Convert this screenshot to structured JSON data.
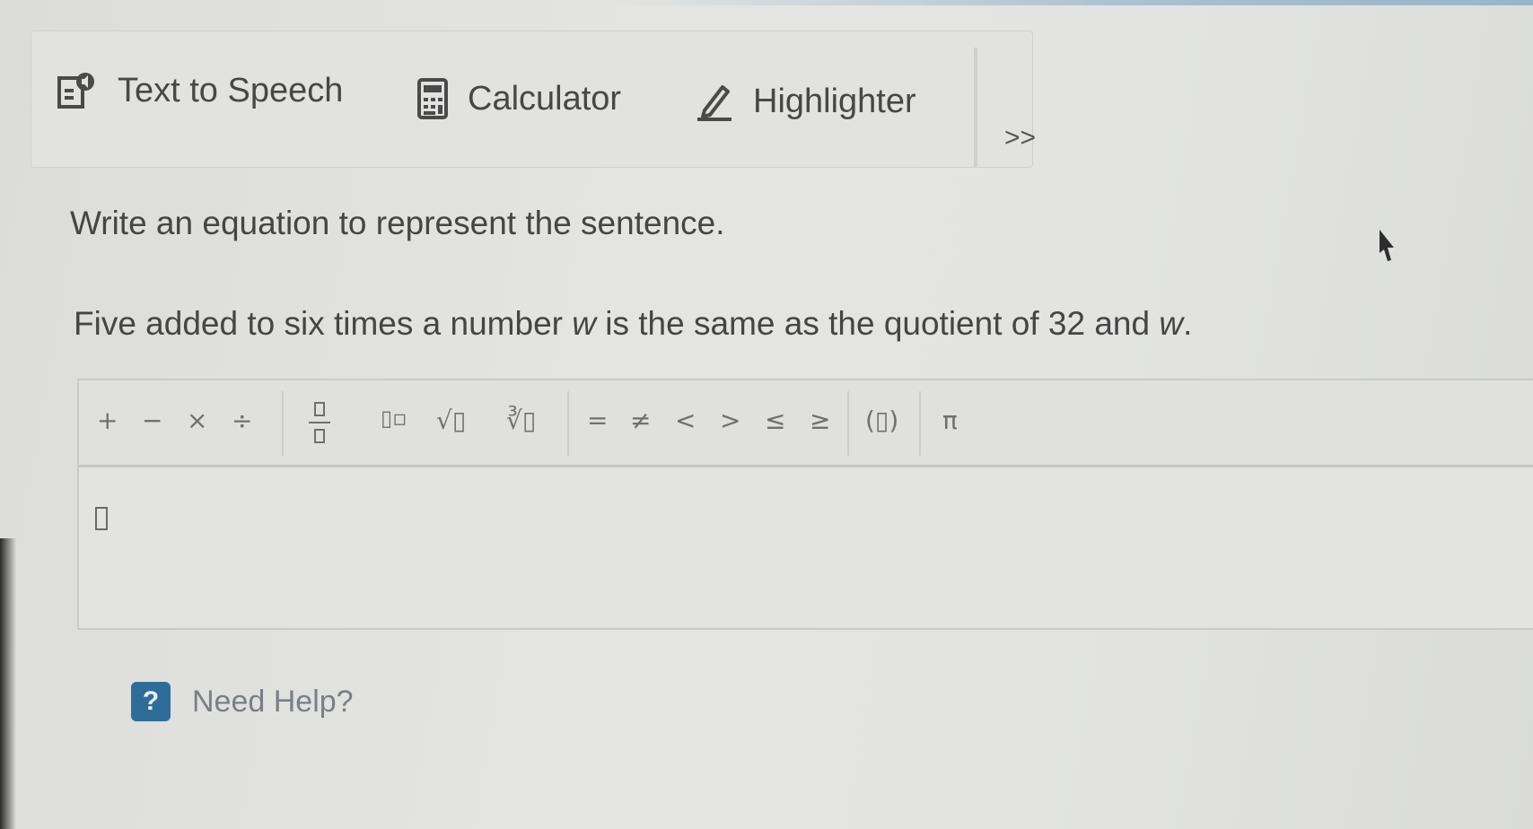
{
  "toolbar": {
    "tts_label": "Text to Speech",
    "calculator_label": "Calculator",
    "highlighter_label": "Highlighter",
    "more_label": ">>"
  },
  "question": {
    "instruction": "Write an equation to represent the sentence.",
    "sentence_part1": "Five added to six times a number ",
    "sentence_var1": "w",
    "sentence_part2": " is the same as the quotient of 32 and ",
    "sentence_var2": "w",
    "sentence_end": "."
  },
  "palette": {
    "plus": "+",
    "minus": "−",
    "times": "×",
    "divide": "÷",
    "power": "▯▫",
    "sqrt": "√▯",
    "nthroot": "∛▯",
    "equals": "=",
    "not_equal": "≠",
    "less_than": "<",
    "greater_than": ">",
    "less_equal": "≤",
    "greater_equal": "≥",
    "parentheses": "(▯)",
    "pi": "π"
  },
  "help": {
    "badge": "?",
    "label": "Need Help?"
  },
  "colors": {
    "help_badge": "#2f6d98",
    "background": "#e2e2e0"
  },
  "icons": [
    "speaker-book-icon",
    "calculator-icon",
    "highlighter-pen-icon",
    "mouse-pointer-icon"
  ]
}
